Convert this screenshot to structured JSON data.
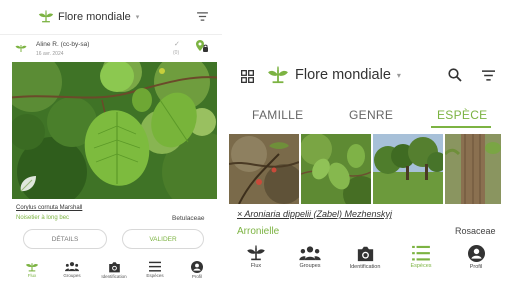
{
  "left": {
    "header": {
      "title": "Flore mondiale",
      "caret": "▾"
    },
    "observation": {
      "author": "Aline R. (cc-by-sa)",
      "date": "16 avr. 2024",
      "check": "✓",
      "count": "(0)",
      "scientific_name": "Corylus cornuta Marshall",
      "common_name": "Noisetier à long bec",
      "family": "Betulaceae"
    },
    "buttons": {
      "details": "DÉTAILS",
      "validate": "VALIDER"
    },
    "nav": [
      {
        "label": "Flux",
        "icon": "plant-icon"
      },
      {
        "label": "Groupes",
        "icon": "groups-icon"
      },
      {
        "label": "Identification",
        "icon": "camera-icon"
      },
      {
        "label": "Espèces",
        "icon": "list-icon"
      },
      {
        "label": "Profil",
        "icon": "profile-icon"
      }
    ]
  },
  "right": {
    "header": {
      "title": "Flore mondiale",
      "caret": "▾"
    },
    "tabs": [
      "FAMILLE",
      "GENRE",
      "ESPÈCE"
    ],
    "active_tab": "ESPÈCE",
    "species": {
      "scientific_name": "× Aroniaria dippelii (Zabel) Mezhenskyj",
      "common_name": "Arronielle",
      "family": "Rosaceae"
    },
    "nav": [
      {
        "label": "Flux",
        "icon": "plant-icon"
      },
      {
        "label": "Groupes",
        "icon": "groups-icon"
      },
      {
        "label": "Identification",
        "icon": "camera-icon"
      },
      {
        "label": "Espèces",
        "icon": "list-icon"
      },
      {
        "label": "Profil",
        "icon": "profile-icon"
      }
    ]
  },
  "colors": {
    "accent": "#7cb342",
    "text": "#333333",
    "muted": "#999999",
    "icon_dark": "#333333"
  }
}
